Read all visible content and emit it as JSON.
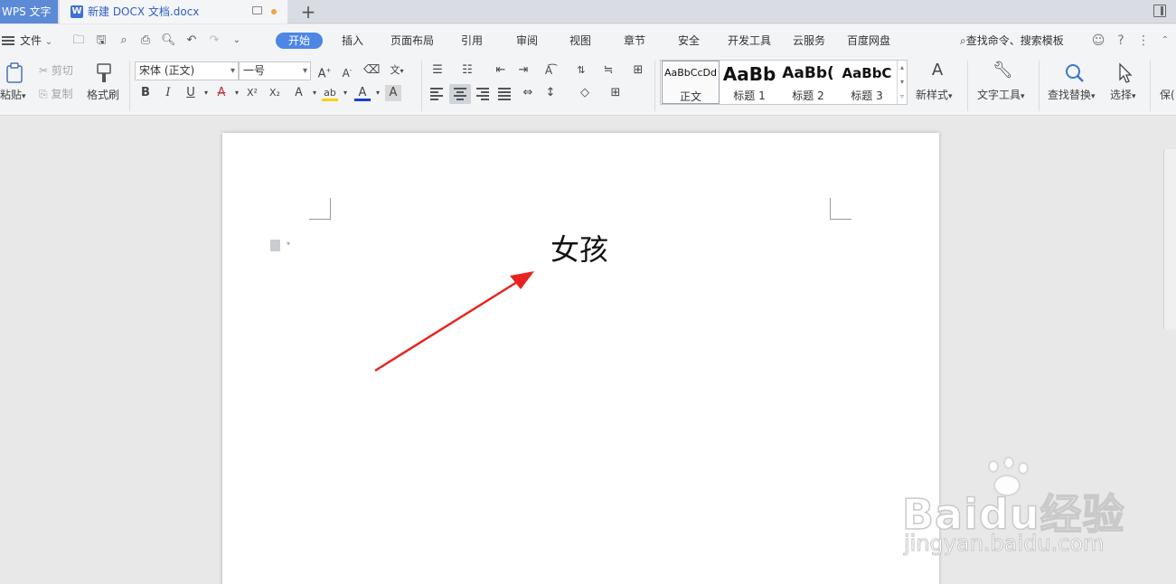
{
  "tabs": {
    "app": "WPS 文字",
    "document": "新建 DOCX 文档.docx",
    "add": "+"
  },
  "menu": {
    "file": "文件",
    "tabs": [
      "开始",
      "插入",
      "页面布局",
      "引用",
      "审阅",
      "视图",
      "章节",
      "安全",
      "开发工具",
      "云服务",
      "百度网盘"
    ],
    "active": "开始",
    "search": "查找命令、搜索模板",
    "help": "?",
    "more": "⋮"
  },
  "ribbon": {
    "paste": "粘贴",
    "cut": "剪切",
    "copy": "复制",
    "format_painter": "格式刷",
    "font_name": "宋体 (正文)",
    "font_size": "一号",
    "bold": "B",
    "italic": "I",
    "underline": "U",
    "strike": "A",
    "superscript": "X²",
    "subscript": "X₂",
    "font_color": "A",
    "styles": [
      {
        "preview": "AaBbCcDd",
        "label": "正文"
      },
      {
        "preview": "AaBb",
        "label": "标题 1"
      },
      {
        "preview": "AaBb(",
        "label": "标题 2"
      },
      {
        "preview": "AaBbC",
        "label": "标题 3"
      }
    ],
    "new_style": "新样式",
    "text_tools": "文字工具",
    "find_replace": "查找替换",
    "select": "选择",
    "save_partial": "保("
  },
  "document": {
    "text": "女孩"
  },
  "colors": {
    "accent": "#4e86e6",
    "arrow": "#e8231f",
    "app_tab": "#5b8ad6"
  },
  "watermark": {
    "main": "Baidu经验",
    "sub": "jingyan.baidu.com"
  }
}
